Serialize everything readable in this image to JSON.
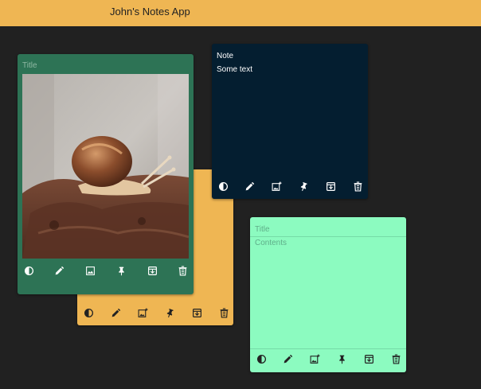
{
  "app": {
    "title": "John's Notes App"
  },
  "notes": [
    {
      "id": "yellow",
      "title_placeholder": "",
      "content": "",
      "background": "#efb653"
    },
    {
      "id": "green",
      "title_placeholder": "Title",
      "content": "",
      "background": "#2d7355",
      "has_image": true
    },
    {
      "id": "navy",
      "title": "Note",
      "content": "Some text",
      "background": "#041e30"
    },
    {
      "id": "mint",
      "title_placeholder": "Title",
      "content_placeholder": "Contents",
      "background": "#8cfbc0"
    }
  ],
  "toolbar": {
    "icons": [
      "contrast-icon",
      "edit-icon",
      "add-image-icon",
      "pin-icon",
      "archive-icon",
      "delete-icon"
    ]
  },
  "colors": {
    "page_bg": "#212121",
    "topbar": "#efb653",
    "yellow_note": "#efb653",
    "green_note": "#2d7355",
    "navy_note": "#041e30",
    "mint_note": "#8cfbc0"
  }
}
